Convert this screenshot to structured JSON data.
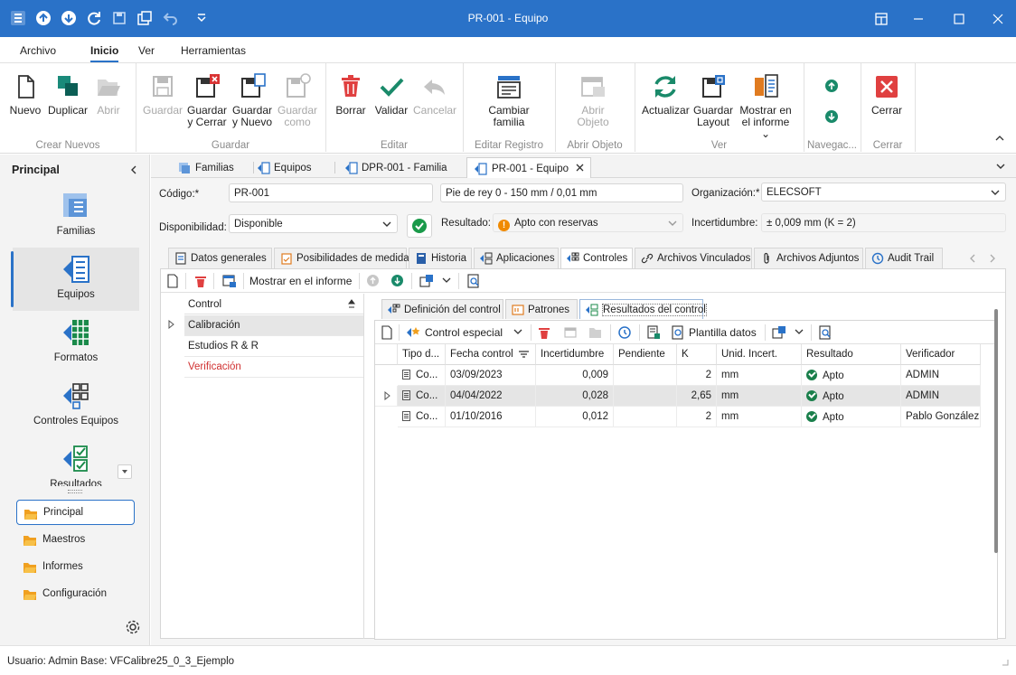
{
  "window": {
    "title": "PR-001 - Equipo",
    "accent": "#2a72c8"
  },
  "menu": {
    "items": [
      "Archivo",
      "Inicio",
      "Ver",
      "Herramientas"
    ],
    "active": "Inicio"
  },
  "ribbon": {
    "groups": {
      "crear": {
        "label": "Crear Nuevos",
        "nuevo": "Nuevo",
        "duplicar": "Duplicar",
        "abrir": "Abrir"
      },
      "guardar": {
        "label": "Guardar",
        "guardar": "Guardar",
        "guardar_cerrar_1": "Guardar",
        "guardar_cerrar_2": "y Cerrar",
        "guardar_nuevo_1": "Guardar",
        "guardar_nuevo_2": "y Nuevo",
        "guardar_como_1": "Guardar",
        "guardar_como_2": "como"
      },
      "editar": {
        "label": "Editar",
        "borrar": "Borrar",
        "validar": "Validar",
        "cancelar": "Cancelar"
      },
      "editar_registro": {
        "label": "Editar Registro",
        "cambiar_1": "Cambiar",
        "cambiar_2": "familia"
      },
      "abrir_objeto": {
        "label": "Abrir Objeto",
        "abrir_1": "Abrir",
        "abrir_2": "Objeto"
      },
      "ver": {
        "label": "Ver",
        "actualizar": "Actualizar",
        "guardar_layout_1": "Guardar",
        "guardar_layout_2": "Layout",
        "mostrar_1": "Mostrar en",
        "mostrar_2": "el informe"
      },
      "navegacion": {
        "label": "Navegac..."
      },
      "cerrar": {
        "label": "Cerrar",
        "cerrar": "Cerrar"
      }
    }
  },
  "sidebar": {
    "title": "Principal",
    "big_items": [
      "Familias",
      "Equipos",
      "Formatos",
      "Controles Equipos",
      "Resultados"
    ],
    "selected": "Equipos",
    "small_items": [
      "Principal",
      "Maestros",
      "Informes",
      "Configuración"
    ]
  },
  "doc_tabs": [
    "Familias",
    "Equipos",
    "DPR-001 - Familia",
    "PR-001 - Equipo"
  ],
  "form": {
    "codigo_label": "Código:*",
    "codigo": "PR-001",
    "descripcion": "Pie de rey 0 - 150 mm / 0,01 mm",
    "organizacion_label": "Organización:*",
    "organizacion": "ELECSOFT",
    "disponibilidad_label": "Disponibilidad:",
    "disponibilidad": "Disponible",
    "resultado_label": "Resultado:",
    "resultado": "Apto con reservas",
    "incertidumbre_label": "Incertidumbre:",
    "incertidumbre": "± 0,009 mm (K = 2)"
  },
  "prop_tabs": [
    "Datos generales",
    "Posibilidades de medida",
    "Historia",
    "Aplicaciones",
    "Controles",
    "Archivos Vinculados",
    "Archivos Adjuntos",
    "Audit Trail"
  ],
  "prop_tab_active": "Controles",
  "controls_toolbar": {
    "mostrar": "Mostrar en el informe"
  },
  "tree": {
    "header": "Control",
    "items": [
      "Calibración",
      "Estudios R & R",
      "Verificación"
    ]
  },
  "inner_tabs": [
    "Definición del control",
    "Patrones",
    "Resultados del control"
  ],
  "inner_tab_active": "Resultados del control",
  "grid_toolbar": {
    "control_especial": "Control especial",
    "plantilla": "Plantilla datos"
  },
  "grid": {
    "columns": [
      "Tipo d...",
      "Fecha control",
      "Incertidumbre",
      "Pendiente",
      "K",
      "Unid. Incert.",
      "Resultado",
      "Verificador"
    ],
    "rows": [
      {
        "tipo": "Co...",
        "fecha": "03/09/2023",
        "incert": "0,009",
        "pend": "",
        "k": "2",
        "unid": "mm",
        "res": "Apto",
        "verif": "ADMIN"
      },
      {
        "tipo": "Co...",
        "fecha": "04/04/2022",
        "incert": "0,028",
        "pend": "",
        "k": "2,65",
        "unid": "mm",
        "res": "Apto",
        "verif": "ADMIN"
      },
      {
        "tipo": "Co...",
        "fecha": "01/10/2016",
        "incert": "0,012",
        "pend": "",
        "k": "2",
        "unid": "mm",
        "res": "Apto",
        "verif": "Pablo González"
      }
    ]
  },
  "status": {
    "usuario": "Usuario: Admin",
    "base": "Base: VFCalibre25_0_3_Ejemplo"
  }
}
